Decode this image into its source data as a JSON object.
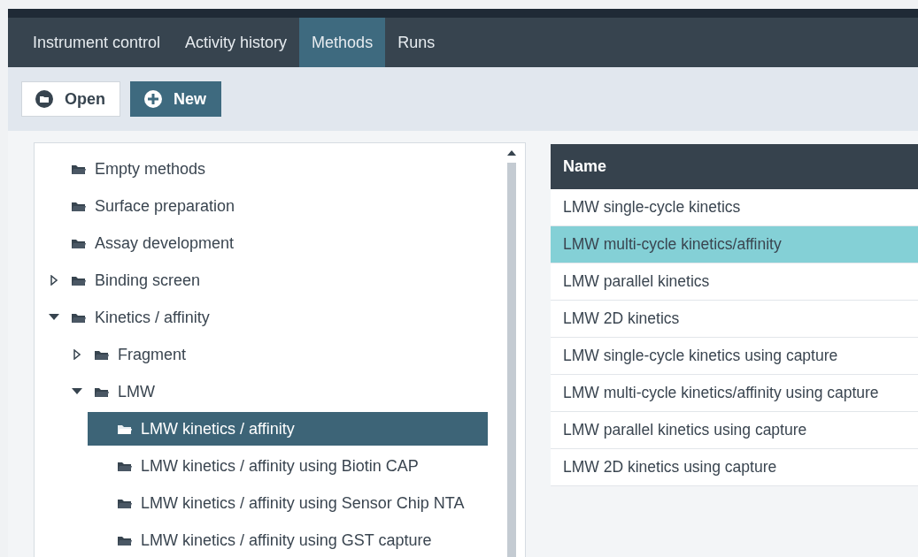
{
  "tabs": [
    {
      "label": "Instrument control",
      "selected": false
    },
    {
      "label": "Activity history",
      "selected": false
    },
    {
      "label": "Methods",
      "selected": true
    },
    {
      "label": "Runs",
      "selected": false
    }
  ],
  "toolbar": [
    {
      "label": "Open",
      "kind": "open"
    },
    {
      "label": "New",
      "kind": "new"
    }
  ],
  "tree": [
    {
      "label": "Empty methods",
      "selected": false
    },
    {
      "label": "Surface preparation",
      "selected": false
    },
    {
      "label": "Assay development",
      "selected": false
    },
    {
      "label": "Binding screen",
      "selected": false,
      "expanded": false
    },
    {
      "label": "Kinetics / affinity",
      "selected": false,
      "expanded": true,
      "children": [
        {
          "label": "Fragment",
          "selected": false,
          "expanded": false
        },
        {
          "label": "LMW",
          "selected": false,
          "expanded": true,
          "children": [
            {
              "label": "LMW kinetics / affinity",
              "selected": true
            },
            {
              "label": "LMW kinetics / affinity using Biotin CAP",
              "selected": false
            },
            {
              "label": "LMW kinetics / affinity using Sensor Chip NTA",
              "selected": false
            },
            {
              "label": "LMW kinetics / affinity using GST capture",
              "selected": false
            }
          ]
        }
      ]
    }
  ],
  "table": {
    "columns": [
      "Name"
    ],
    "rows": [
      {
        "name": "LMW single-cycle kinetics",
        "selected": false
      },
      {
        "name": "LMW multi-cycle kinetics/affinity",
        "selected": true
      },
      {
        "name": "LMW parallel kinetics",
        "selected": false
      },
      {
        "name": "LMW 2D kinetics",
        "selected": false
      },
      {
        "name": "LMW single-cycle kinetics using capture",
        "selected": false
      },
      {
        "name": "LMW multi-cycle kinetics/affinity using capture",
        "selected": false
      },
      {
        "name": "LMW parallel kinetics using capture",
        "selected": false
      },
      {
        "name": "LMW 2D kinetics using capture",
        "selected": false
      }
    ]
  }
}
